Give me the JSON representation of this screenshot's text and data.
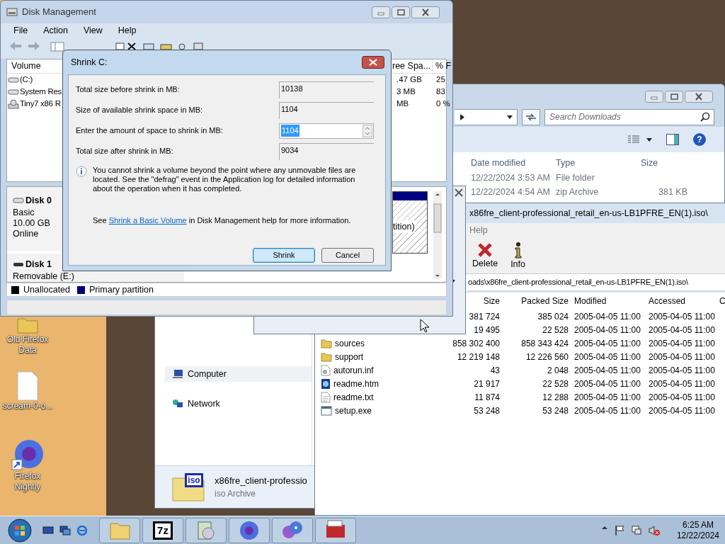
{
  "desktop_icons": [
    {
      "label": "Old Firefox Data",
      "kind": "folder"
    },
    {
      "label": "scream-0-o...",
      "kind": "file"
    },
    {
      "label": "Firefox Nightly",
      "kind": "browser"
    }
  ],
  "explorer": {
    "search": {
      "placeholder": "Search Downloads"
    },
    "help_label": "?",
    "columns": [
      "Date modified",
      "Type",
      "Size"
    ],
    "rows": [
      {
        "date": "12/22/2024 3:53 AM",
        "type": "File folder"
      },
      {
        "date": "12/22/2024 4:54 AM",
        "type": "zip Archive",
        "size": "381 KB"
      }
    ],
    "nav": [
      {
        "label": "Computer",
        "kind": "computer"
      },
      {
        "label": "Network",
        "kind": "network"
      }
    ],
    "details": {
      "name": "x86fre_client-professio",
      "type": "iso Archive",
      "badge": "iso"
    }
  },
  "sevenzip": {
    "title": "x86fre_client-professional_retail_en-us-LB1PFRE_EN(1).iso\\",
    "menu": [
      "Help"
    ],
    "toolbar": [
      {
        "label": "Delete",
        "kind": "delete"
      },
      {
        "label": "Info",
        "kind": "info"
      }
    ],
    "path": "oads\\x86fre_client-professional_retail_en-us-LB1PFRE_EN(1).iso\\",
    "columns": [
      "Size",
      "Packed Size",
      "Modified",
      "Accessed",
      "C"
    ],
    "rows": [
      {
        "size": "381 724",
        "packed": "385 024",
        "modified": "2005-04-05 11:00",
        "accessed": "2005-04-05 11:00"
      },
      {
        "size": "19 495",
        "packed": "22 528",
        "modified": "2005-04-05 11:00",
        "accessed": "2005-04-05 11:00"
      },
      {
        "name": "sources",
        "kind": "folder",
        "size": "858 302 400",
        "packed": "858 343 424",
        "modified": "2005-04-05 11:00",
        "accessed": "2005-04-05 11:00"
      },
      {
        "name": "support",
        "kind": "folder",
        "size": "12 219 148",
        "packed": "12 226 560",
        "modified": "2005-04-05 11:00",
        "accessed": "2005-04-05 11:00"
      },
      {
        "name": "autorun.inf",
        "kind": "settings",
        "size": "43",
        "packed": "2 048",
        "modified": "2005-04-05 11:00",
        "accessed": "2005-04-05 11:00"
      },
      {
        "name": "readme.htm",
        "kind": "web",
        "size": "21 917",
        "packed": "22 528",
        "modified": "2005-04-05 11:00",
        "accessed": "2005-04-05 11:00"
      },
      {
        "name": "readme.txt",
        "kind": "text",
        "size": "11 874",
        "packed": "12 288",
        "modified": "2005-04-05 11:00",
        "accessed": "2005-04-05 11:00"
      },
      {
        "name": "setup.exe",
        "kind": "program",
        "size": "53 248",
        "packed": "53 248",
        "modified": "2005-04-05 11:00",
        "accessed": "2005-04-05 11:00"
      }
    ]
  },
  "disk_management": {
    "title": "Disk Management",
    "menu": [
      "File",
      "Action",
      "View",
      "Help"
    ],
    "columns": [
      "Volume",
      "ree Spa...",
      "% F"
    ],
    "volumes": [
      {
        "name": "(C:)",
        "free": ".47 GB",
        "percent": "25",
        "kind": "disk"
      },
      {
        "name": "System Res",
        "free": "3 MB",
        "percent": "83",
        "kind": "disk"
      },
      {
        "name": "Tiny7 x86 R",
        "free": "MB",
        "percent": "0 %",
        "kind": "optical"
      }
    ],
    "disks": [
      {
        "name": "Disk 0",
        "kind": "fixed",
        "lines": [
          "Basic",
          "10.00 GB",
          "Online"
        ]
      },
      {
        "name": "Disk 1",
        "kind": "removable",
        "lines": [
          "Removable (E:)"
        ]
      }
    ],
    "partition": {
      "label": "tition)",
      "selected": true
    },
    "legend": [
      {
        "label": "Unallocated",
        "color": "#000000"
      },
      {
        "label": "Primary partition",
        "color": "#000080"
      }
    ]
  },
  "shrink_dialog": {
    "title": "Shrink C:",
    "fields": [
      {
        "label": "Total size before shrink in MB:",
        "value": "10138",
        "kind": "readonly"
      },
      {
        "label": "Size of available shrink space in MB:",
        "value": "1104",
        "kind": "readonly"
      },
      {
        "label": "Enter the amount of space to shrink in MB:",
        "value": "1104",
        "kind": "spin"
      },
      {
        "label": "Total size after shrink in MB:",
        "value": "9034",
        "kind": "readonly"
      }
    ],
    "info": "You cannot shrink a volume beyond the point where any unmovable files are located. See the \"defrag\" event in the Application log for detailed information about the operation when it has completed.",
    "help": {
      "before": "See",
      "link": "Shrink a Basic Volume",
      "after": "in Disk Management help for more information."
    },
    "buttons": [
      {
        "label": "Shrink",
        "default": true
      },
      {
        "label": "Cancel",
        "default": false
      }
    ]
  },
  "taskbar": {
    "quick_launch": [
      {
        "kind": "desktop"
      },
      {
        "kind": "switch"
      },
      {
        "kind": "browser"
      }
    ],
    "tasks": [
      {
        "kind": "explorer"
      },
      {
        "kind": "sevenzip",
        "label": "7z"
      },
      {
        "kind": "media"
      },
      {
        "kind": "firefox"
      },
      {
        "kind": "discs"
      },
      {
        "kind": "toolbox"
      }
    ],
    "tray": [
      {
        "kind": "up"
      },
      {
        "kind": "flag"
      },
      {
        "kind": "network"
      },
      {
        "kind": "muted"
      }
    ],
    "clock": {
      "time": "6:25 AM",
      "date": "12/22/2024"
    }
  }
}
